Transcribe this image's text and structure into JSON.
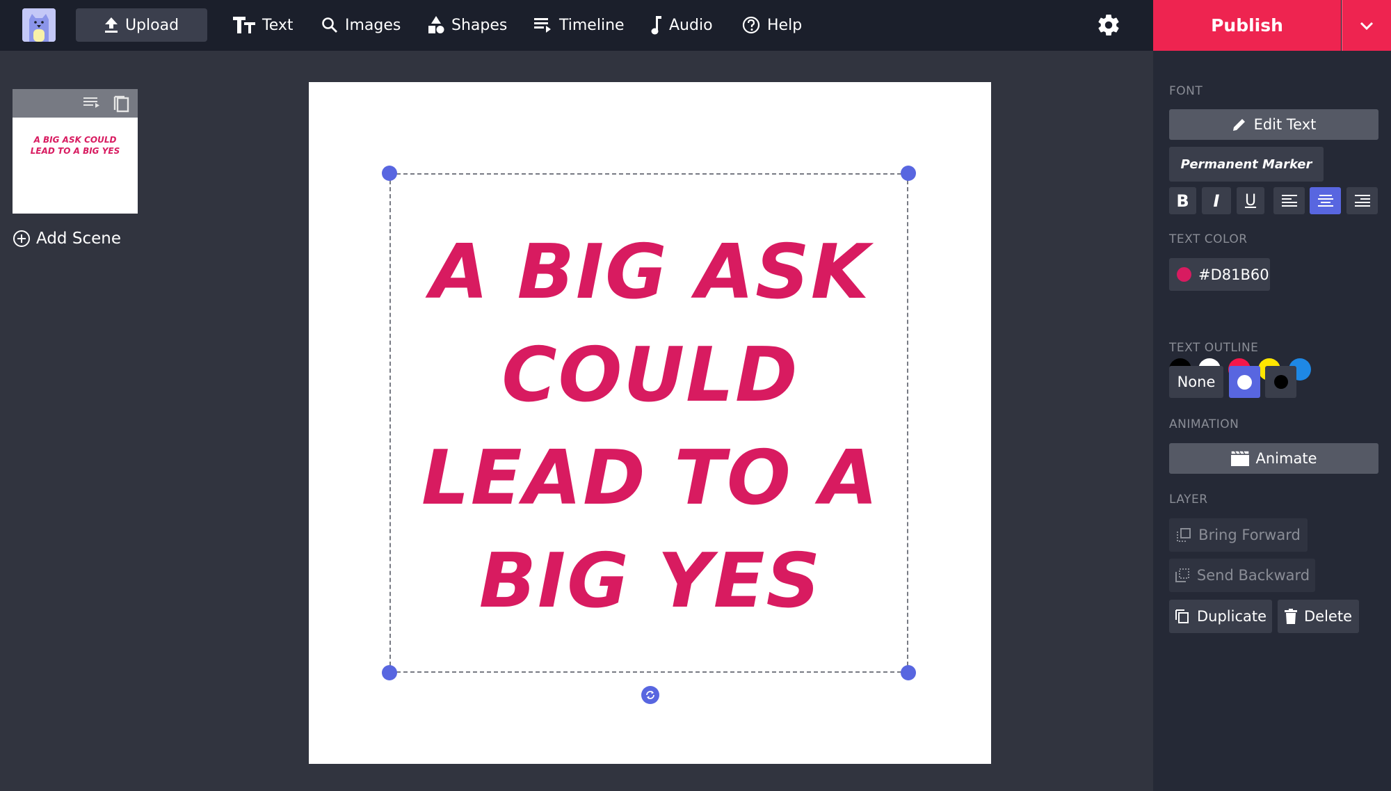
{
  "topbar": {
    "upload": "Upload",
    "nav": [
      {
        "label": "Text",
        "icon": "text-size-icon"
      },
      {
        "label": "Images",
        "icon": "search-icon"
      },
      {
        "label": "Shapes",
        "icon": "shapes-icon"
      },
      {
        "label": "Timeline",
        "icon": "timeline-icon"
      },
      {
        "label": "Audio",
        "icon": "music-note-icon"
      },
      {
        "label": "Help",
        "icon": "help-icon"
      }
    ],
    "publish": "Publish"
  },
  "scenes": {
    "thumb_text": "A big ask could lead to a big yes",
    "add_scene": "Add Scene"
  },
  "canvas": {
    "text": "A big ask could lead to a big yes",
    "text_color": "#D81B60"
  },
  "panel": {
    "font_label": "FONT",
    "edit_text": "Edit Text",
    "font_name": "Permanent Marker",
    "bold": "B",
    "italic": "I",
    "underline": "U",
    "text_color_label": "TEXT COLOR",
    "current_color": "#D81B60",
    "swatches": [
      "#000000",
      "#FFFFFF",
      "#F5174A",
      "#FFE600",
      "#1E88E5"
    ],
    "outline_label": "TEXT OUTLINE",
    "outline_none": "None",
    "animation_label": "ANIMATION",
    "animate": "Animate",
    "layer_label": "LAYER",
    "bring_forward": "Bring Forward",
    "send_backward": "Send Backward",
    "duplicate": "Duplicate",
    "delete": "Delete"
  }
}
